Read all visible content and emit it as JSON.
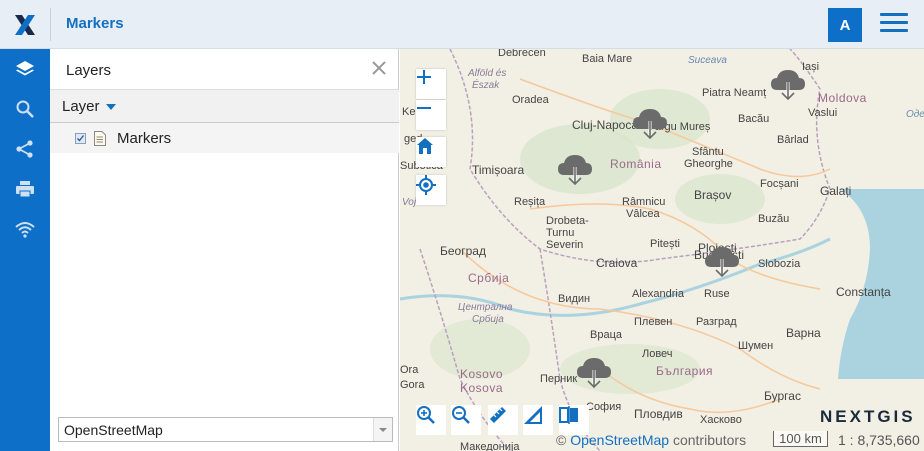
{
  "header": {
    "title": "Markers",
    "user_initial": "A",
    "logo_icon": "x-logo-icon",
    "menu_icon": "hamburger-icon"
  },
  "sidebar": {
    "items": [
      {
        "name": "layers",
        "icon": "layers-icon"
      },
      {
        "name": "search",
        "icon": "search-icon"
      },
      {
        "name": "share",
        "icon": "share-icon"
      },
      {
        "name": "print",
        "icon": "print-icon"
      },
      {
        "name": "wifi",
        "icon": "wifi-icon"
      }
    ]
  },
  "panel": {
    "title": "Layers",
    "layer_dropdown": "Layer",
    "tree": [
      {
        "label": "Markers",
        "checked": true,
        "icon": "document-icon"
      }
    ],
    "basemap_select": "OpenStreetMap"
  },
  "map": {
    "countries": [
      "România",
      "Србија",
      "Moldova",
      "България",
      "Kosovo",
      "Kosova"
    ],
    "regions": [
      "Alföld és",
      "Észak",
      "Централна",
      "Србија"
    ],
    "cities": [
      "Debrecen",
      "Baia Mare",
      "Suceava",
      "Iași",
      "Piatra Neamț",
      "Vaslui",
      "Oradea",
      "Cluj-Napoca",
      "Târgu Mureș",
      "Bacău",
      "Bârlad",
      "Sfântu",
      "Gheorghe",
      "Timișoara",
      "Brașov",
      "Focșani",
      "Galați",
      "Reșița",
      "Râmnicu",
      "Vâlcea",
      "Drobeta-",
      "Turnu",
      "Severin",
      "Pitești",
      "Ploiești",
      "Buzău",
      "Београд",
      "București",
      "Slobozia",
      "Craiova",
      "Constanța",
      "Видин",
      "Alexandria",
      "Ruse",
      "Плевен",
      "Разград",
      "Враца",
      "Варна",
      "Шумен",
      "Ловеч",
      "Перник",
      "София",
      "Бургас",
      "Пловдив",
      "Хасково",
      "Македонија",
      "Ora",
      "Gora",
      "Subotica"
    ],
    "partial_labels": [
      "Ke",
      "ged",
      "Одес",
      "Voj"
    ],
    "attribution_prefix": "©",
    "attribution_link": "OpenStreetMap",
    "attribution_suffix": "contributors",
    "scale_bar": "100 km",
    "scale_ratio": "1 : 8,735,660",
    "brand": "NEXTGIS",
    "controls": [
      "zoom-in",
      "zoom-out",
      "home",
      "locate"
    ],
    "tools": [
      "zoom-in-tool",
      "zoom-out-tool",
      "measure-distance",
      "measure-area",
      "swipe"
    ]
  },
  "colors": {
    "primary": "#0d6fc8",
    "header_bg": "#e8eef6",
    "land": "#f2efe4",
    "sea": "#aad3df",
    "marker": "#6b6b6b"
  }
}
